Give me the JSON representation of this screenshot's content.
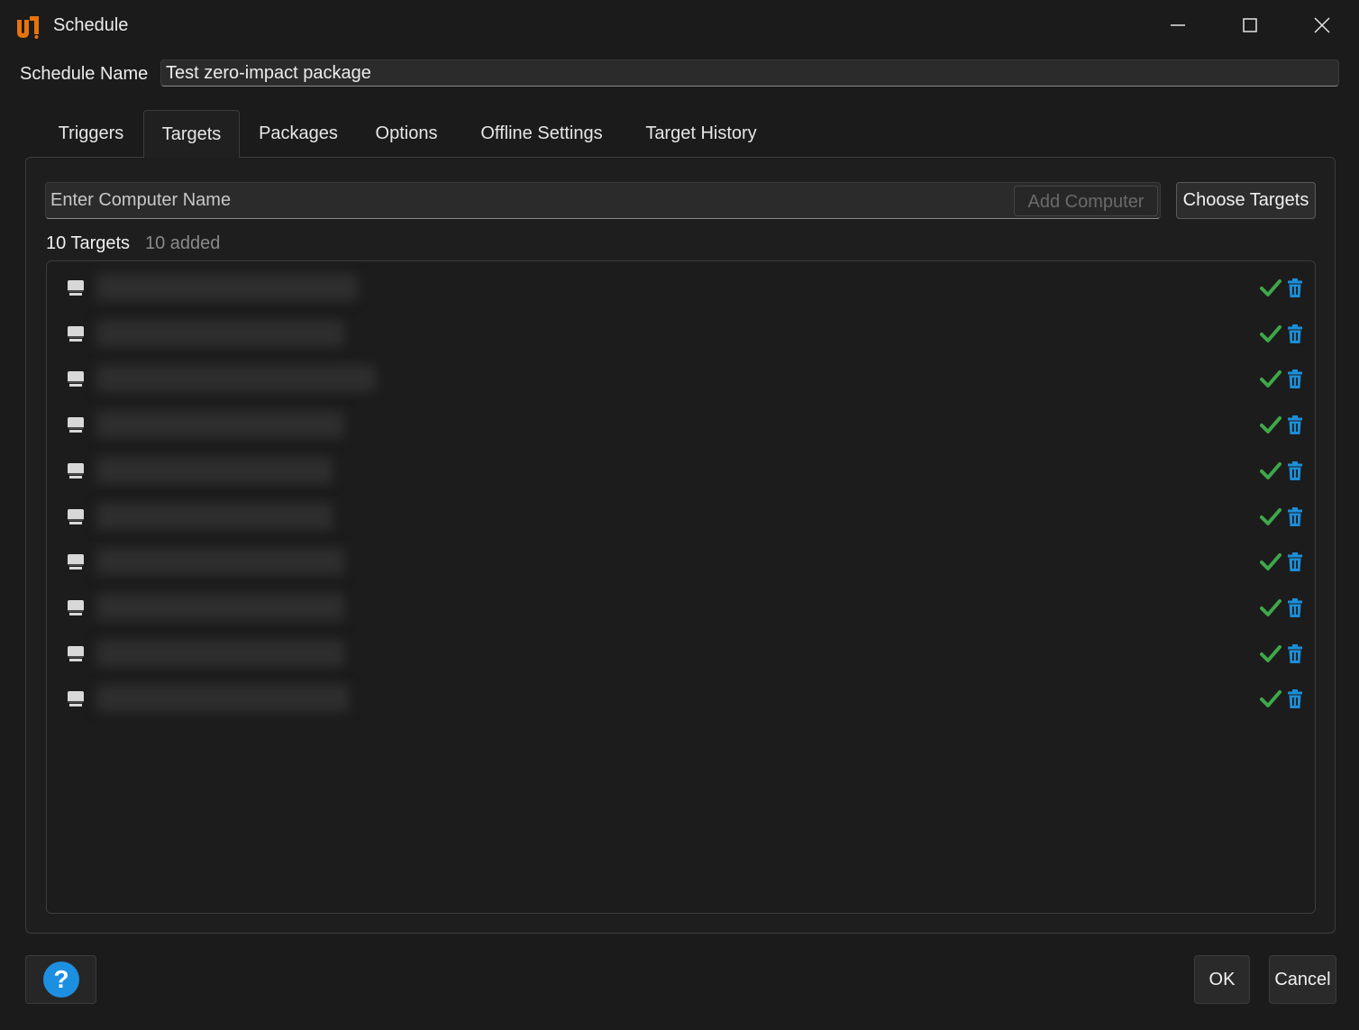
{
  "window": {
    "title": "Schedule",
    "logo_icon": "unicorn-logo-icon",
    "controls": [
      "minimize-icon",
      "maximize-icon",
      "close-icon"
    ]
  },
  "schedule": {
    "name_label": "Schedule Name",
    "name_value": "Test zero-impact package"
  },
  "tabs": [
    {
      "label": "Triggers",
      "active": false
    },
    {
      "label": "Targets",
      "active": true
    },
    {
      "label": "Packages",
      "active": false
    },
    {
      "label": "Options",
      "active": false
    },
    {
      "label": "Offline Settings",
      "active": false
    },
    {
      "label": "Target History",
      "active": false
    }
  ],
  "targets": {
    "input_placeholder": "Enter Computer Name",
    "add_button": "Add Computer",
    "choose_button": "Choose Targets",
    "count_label": "10 Targets",
    "added_label": "10 added",
    "rows": [
      {
        "status": "ok"
      },
      {
        "status": "ok"
      },
      {
        "status": "ok"
      },
      {
        "status": "ok"
      },
      {
        "status": "ok"
      },
      {
        "status": "ok"
      },
      {
        "status": "ok"
      },
      {
        "status": "ok"
      },
      {
        "status": "ok"
      },
      {
        "status": "ok"
      }
    ]
  },
  "footer": {
    "help_icon": "help-icon",
    "ok_button": "OK",
    "cancel_button": "Cancel"
  },
  "colors": {
    "accent_orange": "#e8730c",
    "check_green": "#3ea84a",
    "trash_blue": "#1c8ed8",
    "help_blue": "#1d8fe0"
  }
}
